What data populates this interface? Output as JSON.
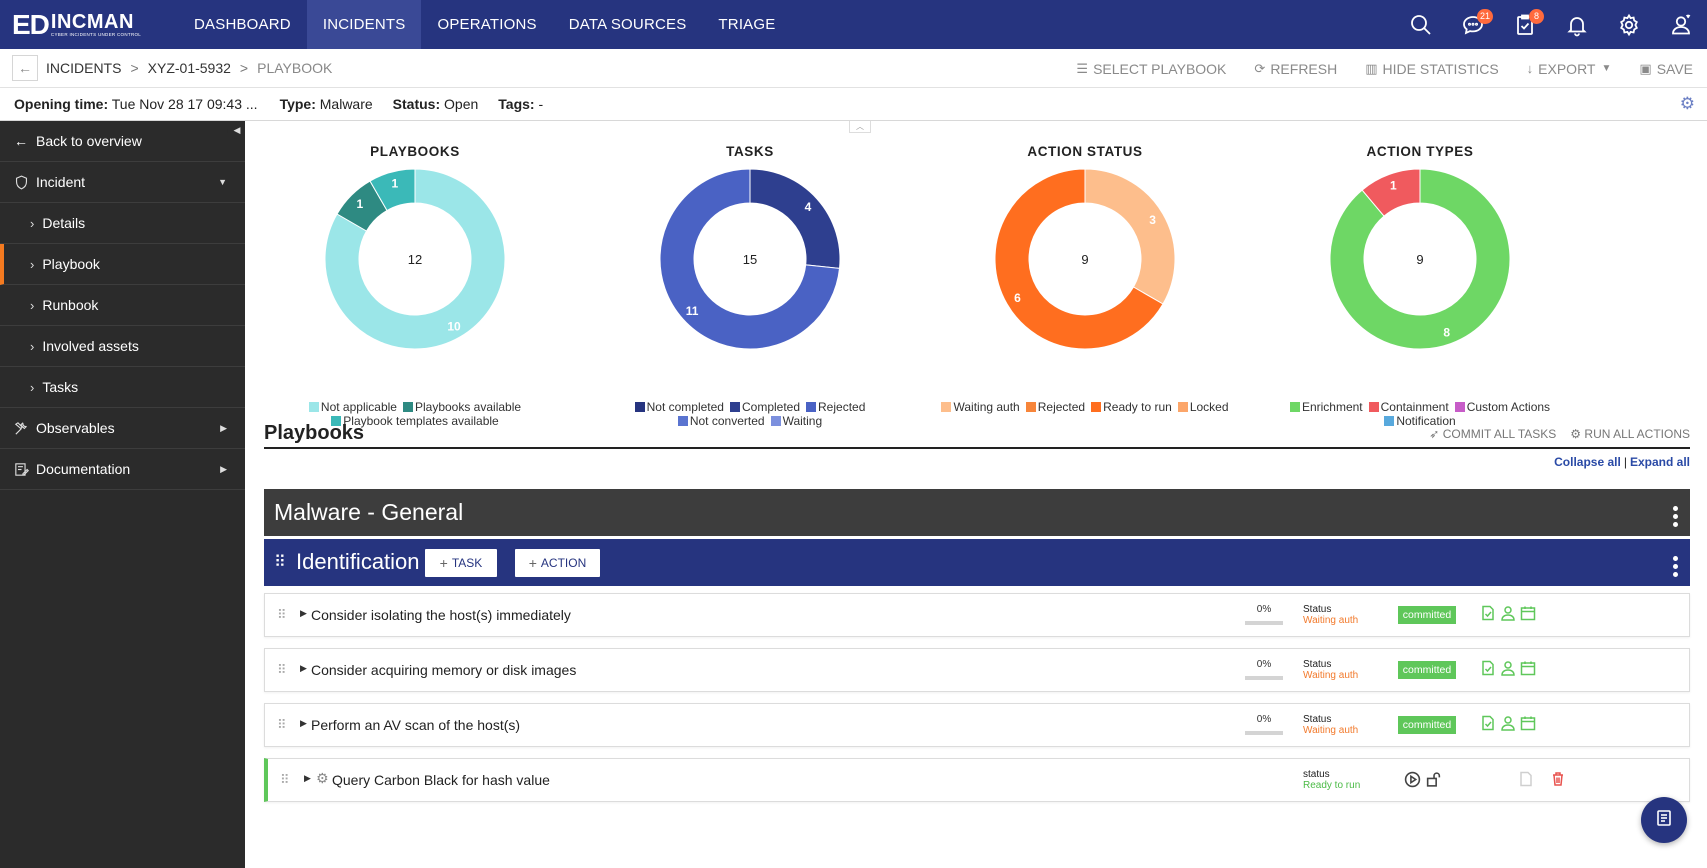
{
  "brand": {
    "name": "INCMAN",
    "tagline": "CYBER INCIDENTS UNDER CONTROL",
    "mark": "ED"
  },
  "nav": {
    "items": [
      {
        "label": "DASHBOARD",
        "active": false
      },
      {
        "label": "INCIDENTS",
        "active": true
      },
      {
        "label": "OPERATIONS",
        "active": false
      },
      {
        "label": "DATA SOURCES",
        "active": false
      },
      {
        "label": "TRIAGE",
        "active": false
      }
    ],
    "icons": [
      {
        "name": "search-icon"
      },
      {
        "name": "chat-icon",
        "badge": "21"
      },
      {
        "name": "clipboard-check-icon",
        "badge": "8"
      },
      {
        "name": "bell-icon"
      },
      {
        "name": "gear-icon"
      },
      {
        "name": "user-icon"
      }
    ]
  },
  "breadcrumb": {
    "items": [
      "INCIDENTS",
      "XYZ-01-5932",
      "PLAYBOOK"
    ],
    "separator": ">"
  },
  "toolbar": {
    "select_playbook": "SELECT PLAYBOOK",
    "refresh": "REFRESH",
    "hide_statistics": "HIDE STATISTICS",
    "export": "EXPORT",
    "save": "SAVE"
  },
  "info": {
    "opening_label": "Opening time:",
    "opening_value": "Tue Nov 28 17 09:43 ...",
    "type_label": "Type:",
    "type_value": "Malware",
    "status_label": "Status:",
    "status_value": "Open",
    "tags_label": "Tags:",
    "tags_value": "-"
  },
  "sidebar": {
    "back": "Back to overview",
    "incident": "Incident",
    "sub_items": [
      {
        "label": "Details",
        "active": false
      },
      {
        "label": "Playbook",
        "active": true
      },
      {
        "label": "Runbook",
        "active": false
      },
      {
        "label": "Involved assets",
        "active": false
      },
      {
        "label": "Tasks",
        "active": false
      }
    ],
    "observables": "Observables",
    "documentation": "Documentation"
  },
  "chart_data": [
    {
      "type": "pie",
      "title": "PLAYBOOKS",
      "total": "12",
      "slices": [
        {
          "name": "Not applicable",
          "value": 10,
          "color": "#9be6e8"
        },
        {
          "name": "Playbooks available",
          "value": 1,
          "color": "#2e8a82"
        },
        {
          "name": "Playbook templates available",
          "value": 1,
          "color": "#3bb9b8"
        }
      ]
    },
    {
      "type": "pie",
      "title": "TASKS",
      "total": "15",
      "slices": [
        {
          "name": "Not completed",
          "value": 0,
          "color": "#26347f"
        },
        {
          "name": "Completed",
          "value": 4,
          "color": "#2e3f8f"
        },
        {
          "name": "Rejected",
          "value": 11,
          "color": "#4a62c4"
        },
        {
          "name": "Not converted",
          "value": 0,
          "color": "#5a74d0"
        },
        {
          "name": "Waiting",
          "value": 0,
          "color": "#7c90de"
        }
      ]
    },
    {
      "type": "pie",
      "title": "ACTION STATUS",
      "total": "9",
      "slices": [
        {
          "name": "Waiting auth",
          "value": 3,
          "color": "#fdbe8c"
        },
        {
          "name": "Rejected",
          "value": 0,
          "color": "#f7853a"
        },
        {
          "name": "Ready to run",
          "value": 6,
          "color": "#ff6e1f"
        },
        {
          "name": "Locked",
          "value": 0,
          "color": "#fca66a"
        }
      ]
    },
    {
      "type": "pie",
      "title": "ACTION TYPES",
      "total": "9",
      "slices": [
        {
          "name": "Enrichment",
          "value": 8,
          "color": "#6ed765"
        },
        {
          "name": "Containment",
          "value": 1,
          "color": "#f05a5e"
        },
        {
          "name": "Custom Actions",
          "value": 0,
          "color": "#c75cc8"
        },
        {
          "name": "Notification",
          "value": 0,
          "color": "#58a9dd"
        }
      ]
    }
  ],
  "playbooks": {
    "title": "Playbooks",
    "commit_all": "COMMIT ALL TASKS",
    "run_all": "RUN ALL ACTIONS",
    "collapse_all": "Collapse all",
    "link_separator": "|",
    "expand_all": "Expand all",
    "group_title": "Malware - General",
    "phase": {
      "title": "Identification",
      "task_btn": "TASK",
      "action_btn": "ACTION"
    },
    "tasks": [
      {
        "title": "Consider isolating the host(s) immediately",
        "percent": "0%",
        "progress": 0,
        "status_label": "Status",
        "status": "Waiting auth",
        "commit": "committed"
      },
      {
        "title": "Consider acquiring memory or disk images",
        "percent": "0%",
        "progress": 0,
        "status_label": "Status",
        "status": "Waiting auth",
        "commit": "committed"
      },
      {
        "title": "Perform an AV scan of the host(s)",
        "percent": "0%",
        "progress": 0,
        "status_label": "Status",
        "status": "Waiting auth",
        "commit": "committed"
      }
    ],
    "action": {
      "title": "Query Carbon Black for hash value",
      "status_label": "status",
      "status": "Ready to run"
    }
  },
  "colors": {
    "brand": "#26347f",
    "accent": "#f47a20",
    "waiting": "#f27a2c",
    "ready": "#4cbb47",
    "committed": "#5fc75a"
  }
}
